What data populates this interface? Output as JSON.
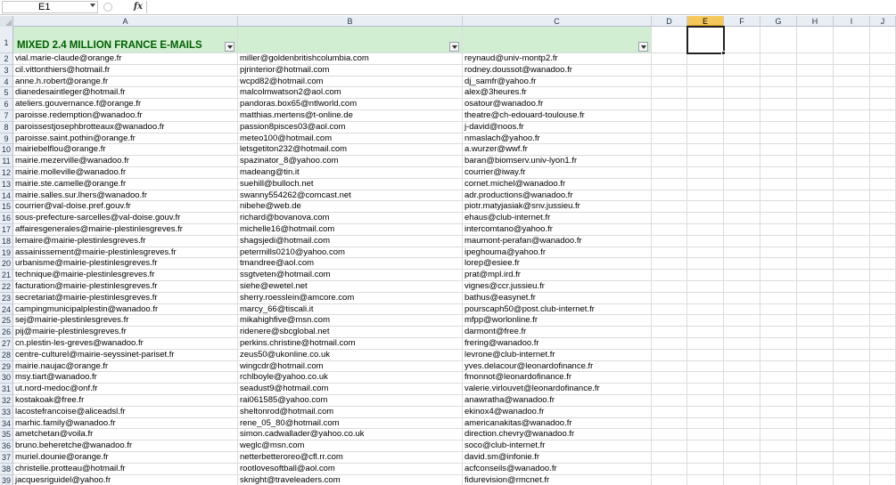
{
  "formula_bar": {
    "name_box": "E1",
    "fx_label": "fx",
    "formula": ""
  },
  "columns": [
    "A",
    "B",
    "C",
    "D",
    "E",
    "F",
    "G",
    "H",
    "I",
    "J"
  ],
  "active_column": "E",
  "header_title": "MIXED 2.4 MILLION FRANCE E-MAILS",
  "rows": [
    {
      "n": "1",
      "a": "",
      "b": "",
      "c": ""
    },
    {
      "n": "2",
      "a": "vial.marie-claude@orange.fr",
      "b": "miller@goldenbritishcolumbia.com",
      "c": "reynaud@univ-montp2.fr"
    },
    {
      "n": "3",
      "a": "cil.vittonthiers@hotmail.fr",
      "b": "pjrinterior@hotmail.com",
      "c": "rodney.doussot@wanadoo.fr"
    },
    {
      "n": "4",
      "a": "anne.h.robert@orange.fr",
      "b": "wcpd82@hotmail.com",
      "c": "dj_samfr@yahoo.fr"
    },
    {
      "n": "5",
      "a": "dianedesaintleger@hotmail.fr",
      "b": "malcolmwatson2@aol.com",
      "c": "alex@3heures.fr"
    },
    {
      "n": "6",
      "a": "ateliers.gouvernance.f@orange.fr",
      "b": "pandoras.box65@ntlworld.com",
      "c": "osatour@wanadoo.fr"
    },
    {
      "n": "7",
      "a": "paroisse.redemption@wanadoo.fr",
      "b": "matthias.mertens@t-online.de",
      "c": "theatre@ch-edouard-toulouse.fr"
    },
    {
      "n": "8",
      "a": "paroissestjosephbrotteaux@wanadoo.fr",
      "b": "passion8pisces03@aol.com",
      "c": "j-david@noos.fr"
    },
    {
      "n": "9",
      "a": "paroisse.saint.pothin@orange.fr",
      "b": "meteo100@hotmail.com",
      "c": "nmaslach@yahoo.fr"
    },
    {
      "n": "10",
      "a": "mairiebelflou@orange.fr",
      "b": "letsgetiton232@hotmail.com",
      "c": "a.wurzer@wwf.fr"
    },
    {
      "n": "11",
      "a": "mairie.mezerville@wanadoo.fr",
      "b": "spazinator_8@yahoo.com",
      "c": "baran@biomserv.univ-lyon1.fr"
    },
    {
      "n": "12",
      "a": "mairie.molleville@wanadoo.fr",
      "b": "madeang@tin.it",
      "c": "courrier@iway.fr"
    },
    {
      "n": "13",
      "a": "mairie.ste.camelle@orange.fr",
      "b": "suehill@bulloch.net",
      "c": "cornet.michel@wanadoo.fr"
    },
    {
      "n": "14",
      "a": "mairie.salles.sur.lhers@wanadoo.fr",
      "b": "swanny554262@comcast.net",
      "c": "adr.productions@wanadoo.fr"
    },
    {
      "n": "15",
      "a": "courrier@val-doise.pref.gouv.fr",
      "b": "nibehe@web.de",
      "c": "piotr.matyjasiak@snv.jussieu.fr"
    },
    {
      "n": "16",
      "a": "sous-prefecture-sarcelles@val-doise.gouv.fr",
      "b": "richard@bovanova.com",
      "c": "ehaus@club-internet.fr"
    },
    {
      "n": "17",
      "a": "affairesgenerales@mairie-plestinlesgreves.fr",
      "b": "michelle16@hotmail.com",
      "c": "intercomtano@yahoo.fr"
    },
    {
      "n": "18",
      "a": "lemaire@mairie-plestinlesgreves.fr",
      "b": "shagsjedi@hotmail.com",
      "c": "maumont-perafan@wanadoo.fr"
    },
    {
      "n": "19",
      "a": "assainissement@mairie-plestinlesgreves.fr",
      "b": "petermills0210@yahoo.com",
      "c": "ipeghouma@yahoo.fr"
    },
    {
      "n": "20",
      "a": "urbanisme@mairie-plestinlesgreves.fr",
      "b": "tmandree@aol.com",
      "c": "lorep@esiee.fr"
    },
    {
      "n": "21",
      "a": "technique@mairie-plestinlesgreves.fr",
      "b": "ssgtveten@hotmail.com",
      "c": "prat@mpl.ird.fr"
    },
    {
      "n": "22",
      "a": "facturation@mairie-plestinlesgreves.fr",
      "b": "siehe@ewetel.net",
      "c": "vignes@ccr.jussieu.fr"
    },
    {
      "n": "23",
      "a": "secretariat@mairie-plestinlesgreves.fr",
      "b": "sherry.roesslein@amcore.com",
      "c": "bathus@easynet.fr"
    },
    {
      "n": "24",
      "a": "campingmunicipalplestin@wanadoo.fr",
      "b": "marcy_66@tiscali.it",
      "c": "pourscaph50@post.club-internet.fr"
    },
    {
      "n": "25",
      "a": "sej@mairie-plestinlesgreves.fr",
      "b": "mikahighfive@msn.com",
      "c": "mfpp@worlonline.fr"
    },
    {
      "n": "26",
      "a": "pij@mairie-plestinlesgreves.fr",
      "b": "ridenere@sbcglobal.net",
      "c": "darmont@free.fr"
    },
    {
      "n": "27",
      "a": "cn.plestin-les-greves@wanadoo.fr",
      "b": "perkins.christine@hotmail.com",
      "c": "frering@wanadoo.fr"
    },
    {
      "n": "28",
      "a": "centre-culturel@mairie-seyssinet-pariset.fr",
      "b": "zeus50@ukonline.co.uk",
      "c": "levrone@club-internet.fr"
    },
    {
      "n": "29",
      "a": "mairie.naujac@orange.fr",
      "b": "wingcdr@hotmail.com",
      "c": "yves.delacour@leonardofinance.fr"
    },
    {
      "n": "30",
      "a": "msy.tiart@wanadoo.fr",
      "b": "rchlboyle@yahoo.co.uk",
      "c": "fmonnot@leonardofinance.fr"
    },
    {
      "n": "31",
      "a": "ut.nord-medoc@onf.fr",
      "b": "seadust9@hotmail.com",
      "c": "valerie.virlouvet@leonardofinance.fr"
    },
    {
      "n": "32",
      "a": "kostakoak@free.fr",
      "b": "rai061585@yahoo.com",
      "c": "anawratha@wanadoo.fr"
    },
    {
      "n": "33",
      "a": "lacostefrancoise@aliceadsl.fr",
      "b": "sheltonrod@hotmail.com",
      "c": "ekinox4@wanadoo.fr"
    },
    {
      "n": "34",
      "a": "marhic.family@wanadoo.fr",
      "b": "rene_05_80@hotmail.com",
      "c": "americanakitas@wanadoo.fr"
    },
    {
      "n": "35",
      "a": "ametchetan@voila.fr",
      "b": "simon.cadwallader@yahoo.co.uk",
      "c": "direction.chevry@wanadoo.fr"
    },
    {
      "n": "36",
      "a": "bruno.beheretche@wanadoo.fr",
      "b": "weglc@msn.com",
      "c": "soco@club-internet.fr"
    },
    {
      "n": "37",
      "a": "muriel.dounie@orange.fr",
      "b": "netterbetteroreo@cfl.rr.com",
      "c": "david.sm@infonie.fr"
    },
    {
      "n": "38",
      "a": "christelle.protteau@hotmail.fr",
      "b": "rootlovesoftball@aol.com",
      "c": "acfconseils@wanadoo.fr"
    },
    {
      "n": "39",
      "a": "jacquesriguidel@yahoo.fr",
      "b": "sknight@traveleaders.com",
      "c": "fidurevision@rmcnet.fr"
    }
  ]
}
